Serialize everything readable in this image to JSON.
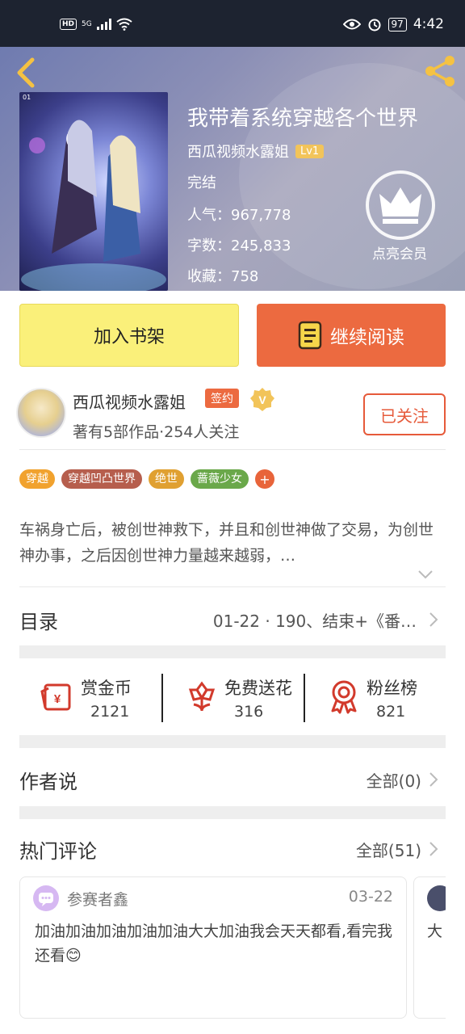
{
  "status_bar": {
    "hd": "HD",
    "network": "5G",
    "battery": "97",
    "time": "4:42"
  },
  "book": {
    "title": "我带着系统穿越各个世界",
    "author": "西瓜视频水露姐",
    "level": "Lv1",
    "status": "完结",
    "popularity": "人气：967,778",
    "word_count": "字数：245,833",
    "favorites": "收藏：758",
    "cover_tag": "01"
  },
  "vip": {
    "label": "点亮会员"
  },
  "actions": {
    "add_shelf": "加入书架",
    "continue_reading": "继续阅读"
  },
  "author": {
    "name": "西瓜视频水露姐",
    "sign_badge": "签约",
    "stats": "著有5部作品·254人关注",
    "follow_label": "已关注"
  },
  "tags": [
    {
      "label": "穿越",
      "color": "#f1a22e"
    },
    {
      "label": "穿越凹凸世界",
      "color": "#b65e4d"
    },
    {
      "label": "绝世",
      "color": "#e0a031"
    },
    {
      "label": "蔷薇少女",
      "color": "#6aa84a"
    }
  ],
  "description": "车祸身亡后，被创世神救下，并且和创世神做了交易，为创世神办事，之后因创世神力量越来越弱，…",
  "toc": {
    "label": "目录",
    "value": "01-22 · 190、结束+《番…"
  },
  "stats": [
    {
      "label": "赏金币",
      "value": "2121",
      "icon": "red-envelope-icon"
    },
    {
      "label": "免费送花",
      "value": "316",
      "icon": "flower-icon"
    },
    {
      "label": "粉丝榜",
      "value": "821",
      "icon": "medal-icon"
    }
  ],
  "author_says": {
    "label": "作者说",
    "more": "全部(0)"
  },
  "hot_comments": {
    "label": "热门评论",
    "more": "全部(51)"
  },
  "comments": [
    {
      "user": "参赛者鑫",
      "date": "03-22",
      "text": "加油加油加油加油加油大大加油我会天天都看,看完我还看😊"
    },
    {
      "text": "大"
    }
  ],
  "colors": {
    "accent": "#ec6a40",
    "shelf": "#faf07a",
    "vip_gold": "#f2c45a"
  }
}
